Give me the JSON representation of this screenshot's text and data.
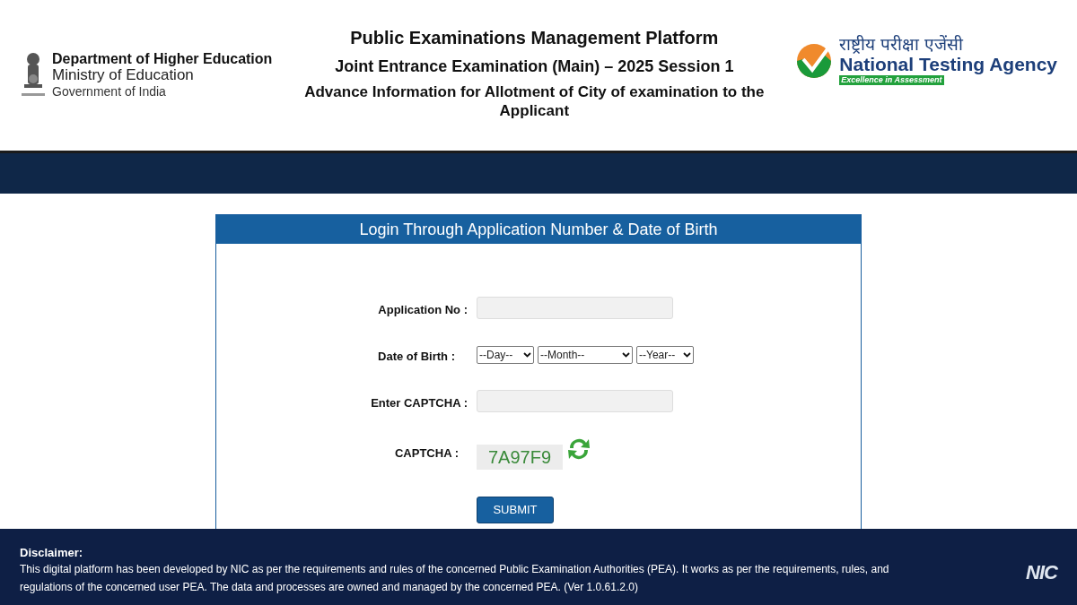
{
  "header": {
    "left_logo": {
      "department": "Department of Higher Education",
      "ministry": "Ministry of Education",
      "government": "Government of India"
    },
    "titles": [
      "Public Examinations Management Platform",
      "Joint Entrance Examination (Main) – 2025 Session 1",
      "Advance Information for Allotment of City of examination to the Applicant"
    ],
    "right_logo": {
      "hindi": "राष्ट्रीय परीक्षा एजेंसी",
      "name": "National Testing Agency",
      "tagline": "Excellence in Assessment"
    }
  },
  "login": {
    "title": "Login Through Application Number & Date of Birth",
    "fields": [
      {
        "kind": "input",
        "label": "Application No :"
      },
      {
        "kind": "selects",
        "label": "Date of Birth :",
        "selects": [
          "--Day--",
          "--Month--",
          "--Year--"
        ]
      },
      {
        "kind": "input",
        "label": "Enter CAPTCHA :"
      },
      {
        "kind": "captcha",
        "label": "CAPTCHA :",
        "value": "7A97F9"
      }
    ],
    "submit": "SUBMIT"
  },
  "footer": {
    "heading": "Disclaimer:",
    "text": "This digital platform has been developed by NIC as per the requirements and rules of the concerned Public Examination Authorities (PEA). It works as per the requirements, rules, and regulations of the concerned user PEA. The data and processes are owned and managed by the concerned PEA. (Ver 1.0.61.2.0)",
    "logo": "NIC"
  }
}
